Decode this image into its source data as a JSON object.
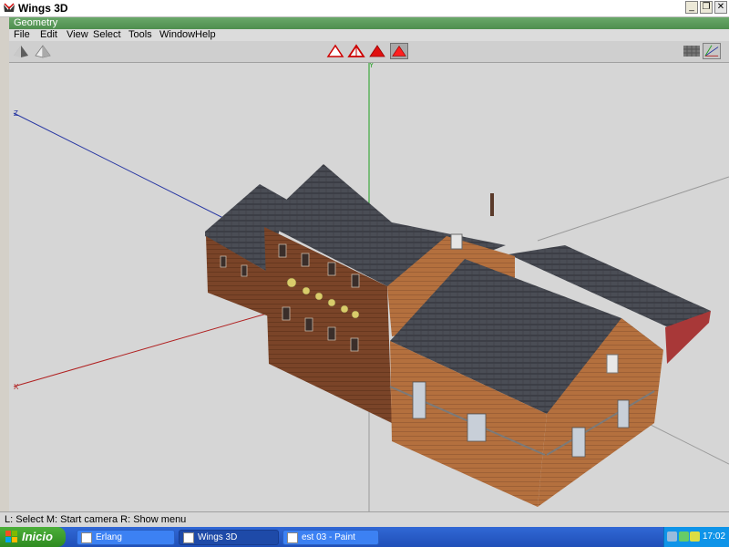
{
  "window": {
    "title": "Wings 3D",
    "controls": {
      "minimize": "_",
      "maximize": "❐",
      "close": "✕"
    }
  },
  "geometry_header": {
    "title": "Geometry"
  },
  "menu": {
    "items": [
      "File",
      "Edit",
      "View",
      "Select",
      "Tools",
      "Window",
      "Help"
    ]
  },
  "toolbar": {
    "left_buttons": [
      "smooth-shading-icon",
      "wireframe-shading-icon"
    ],
    "selection_modes": [
      "vertex-select-icon",
      "edge-select-icon",
      "face-select-icon",
      "body-select-icon"
    ],
    "active_selection_mode": "body-select-icon",
    "right_buttons": [
      "groundplane-icon",
      "axes-icon"
    ]
  },
  "viewport": {
    "axis_labels": {
      "y": "Y",
      "z": "Z",
      "x": "X"
    },
    "axis_colors": {
      "x": "#b02020",
      "y": "#20a020",
      "z": "#2030a0"
    },
    "background": "#d6d6d6"
  },
  "status": {
    "text": "L: Select   M: Start camera   R: Show menu"
  },
  "taskbar": {
    "start_label": "Inicio",
    "tasks": [
      {
        "label": "Erlang",
        "active": false
      },
      {
        "label": "Wings 3D",
        "active": true
      },
      {
        "label": "est 03 - Paint",
        "active": false
      }
    ],
    "clock": "17:02"
  }
}
